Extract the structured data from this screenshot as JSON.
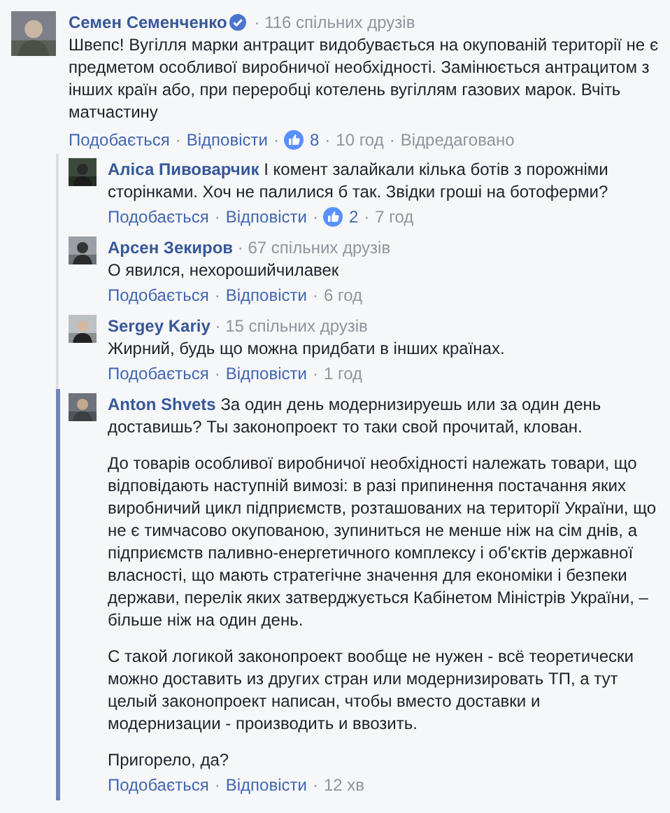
{
  "separator": "·",
  "comment": {
    "author": "Семен Семенченко",
    "verified": true,
    "mutual": "116 спільних друзів",
    "paragraphs": [
      "Швепс! Вугілля марки антрацит видобувається на окупованій території не є предметом особливої виробничої необхідності. Замінюється антрацитом з інших країн або, при переробці котелень вугіллям газових марок. Вчіть матчастину"
    ],
    "like": "Подобається",
    "reply": "Відповісти",
    "likes": "8",
    "time": "10 год",
    "edited": "Відредаговано"
  },
  "replies": [
    {
      "author": "Аліса Пивоварчик",
      "highlighted": false,
      "paragraphs": [
        "І комент залайкали кілька ботів з порожніми сторінками. Хоч не палилися б так. Звідки гроші на ботоферми?"
      ],
      "like": "Подобається",
      "reply": "Відповісти",
      "likes": "2",
      "time": "7 год"
    },
    {
      "author": "Арсен Зекиров",
      "mutual": "67 спільних друзів",
      "highlighted": false,
      "paragraphs": [
        "О явился, нехорошийчилавек"
      ],
      "like": "Подобається",
      "reply": "Відповісти",
      "time": "6 год"
    },
    {
      "author": "Sergey Kariy",
      "mutual": "15 спільних друзів",
      "highlighted": false,
      "paragraphs": [
        "Жирний, будь що можна придбати в інших країнах."
      ],
      "like": "Подобається",
      "reply": "Відповісти",
      "time": "1 год"
    },
    {
      "author": "Anton Shvets",
      "highlighted": true,
      "paragraphs": [
        "За один день модернизируешь или за один день доставишь? Ты законопроект то таки свой прочитай, клован.",
        "До товарів особливої виробничої необхідності належать товари, що відповідають наступній вимозі: в разі припинення постачання яких виробничий цикл підприємств, розташованих на території України, що не є тимчасово окупованою, зупиниться не менше ніж на сім днів, а підприємств паливно-енергетичного комплексу і об'єктів державної власності, що мають стратегічне значення для економіки і безпеки держави, перелік яких затверджується Кабінетом Міністрів України, – більше ніж на один день.",
        "С такой логикой законопроект вообще не нужен - всё теоретически можно доставить из других стран или модернизировать ТП, а тут целый законопроект написан, чтобы вместо доставки и модернизации - производить и ввозить.",
        "Пригорело, да?"
      ],
      "like": "Подобається",
      "reply": "Відповісти",
      "time": "12 хв"
    }
  ]
}
